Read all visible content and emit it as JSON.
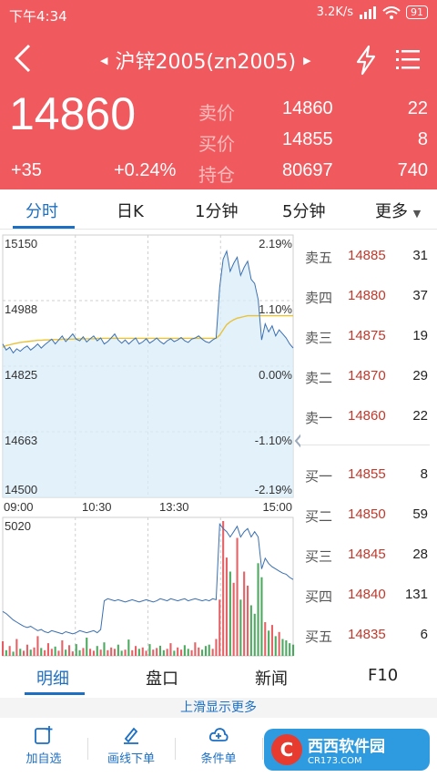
{
  "status": {
    "time": "下午4:34",
    "speed": "3.2K/s",
    "battery": "91"
  },
  "nav": {
    "title": "沪锌2005(zn2005)"
  },
  "quote": {
    "last": "14860",
    "change": "+35",
    "change_pct": "+0.24%",
    "rows": [
      {
        "label": "卖价",
        "v1": "14860",
        "v2": "22"
      },
      {
        "label": "买价",
        "v1": "14855",
        "v2": "8"
      },
      {
        "label": "持仓",
        "v1": "80697",
        "v2": "740"
      }
    ]
  },
  "tabs": [
    "分时",
    "日K",
    "1分钟",
    "5分钟",
    "更多"
  ],
  "chart_data": {
    "type": "line",
    "price_ticks": [
      "15150",
      "14988",
      "14825",
      "14663",
      "14500"
    ],
    "pct_ticks": [
      "2.19%",
      "1.10%",
      "0.00%",
      "-1.10%",
      "-2.19%"
    ],
    "time_ticks": [
      "09:00",
      "10:30",
      "13:30",
      "15:00"
    ],
    "volume_max_label": "5020",
    "ylim": [
      14500,
      15150
    ],
    "base_price": 14825,
    "series": [
      {
        "values": [
          14880,
          14865,
          14872,
          14858,
          14868,
          14862,
          14870,
          14875,
          14865,
          14872,
          14880,
          14870,
          14878,
          14885,
          14892,
          14880,
          14890,
          14900,
          14886,
          14895,
          14905,
          14892,
          14888,
          14898,
          14885,
          14893,
          14900,
          14888,
          14895,
          14880,
          14886,
          14895,
          14905,
          14890,
          14882,
          14890,
          14880,
          14888,
          14895,
          14880,
          14885,
          14893,
          14882,
          14888,
          14895,
          14886,
          14880,
          14888,
          14893,
          14886,
          14890,
          14896,
          14888,
          14884,
          14892,
          14895,
          14900,
          14892,
          14886,
          14883,
          14890,
          14895,
          15020,
          15090,
          15110,
          15060,
          15080,
          15095,
          15050,
          15070,
          15085,
          15040,
          15030,
          14990,
          14890,
          14930,
          14910,
          14925,
          14900,
          14915,
          14905,
          14895,
          14880,
          14870
        ]
      },
      {
        "values": [
          14872,
          14876,
          14878,
          14880,
          14882,
          14884,
          14885,
          14886,
          14887,
          14888,
          14889,
          14889,
          14890,
          14890,
          14891,
          14891,
          14891,
          14892,
          14892,
          14892,
          14892,
          14893,
          14893,
          14893,
          14893,
          14893,
          14893,
          14894,
          14894,
          14894,
          14894,
          14894,
          14894,
          14894,
          14894,
          14894,
          14894,
          14894,
          14894,
          14894,
          14894,
          14894,
          14894,
          14894,
          14894,
          14894,
          14894,
          14894,
          14894,
          14894,
          14894,
          14894,
          14894,
          14894,
          14894,
          14894,
          14894,
          14894,
          14894,
          14894,
          14894,
          14894,
          14902,
          14915,
          14928,
          14935,
          14940,
          14944,
          14946,
          14948,
          14950,
          14950,
          14950,
          14950,
          14950,
          14950,
          14950,
          14950,
          14950,
          14950,
          14950,
          14950,
          14950,
          14950
        ]
      }
    ],
    "volume": [
      52,
      20,
      35,
      15,
      60,
      25,
      18,
      40,
      22,
      30,
      70,
      28,
      20,
      45,
      25,
      33,
      18,
      55,
      22,
      38,
      16,
      42,
      20,
      28,
      65,
      25,
      18,
      35,
      22,
      48,
      20,
      30,
      25,
      40,
      18,
      22,
      58,
      20,
      35,
      25,
      30,
      18,
      42,
      22,
      28,
      36,
      20,
      25,
      45,
      18,
      30,
      22,
      38,
      25,
      20,
      48,
      30,
      22,
      35,
      40,
      25,
      60,
      200,
      480,
      350,
      300,
      260,
      420,
      200,
      300,
      250,
      180,
      150,
      330,
      280,
      120,
      90,
      110,
      70,
      85,
      60,
      55,
      45,
      40
    ],
    "oi": [
      4200,
      4180,
      4150,
      4120,
      4100,
      4080,
      4060,
      4050,
      4060,
      4040,
      4020,
      4030,
      4010,
      4000,
      4020,
      4010,
      4000,
      3990,
      4010,
      4000,
      3990,
      4000,
      4020,
      4010,
      4000,
      4010,
      4020,
      4000,
      4030,
      4300,
      4320,
      4310,
      4300,
      4310,
      4300,
      4290,
      4300,
      4310,
      4300,
      4290,
      4300,
      4310,
      4300,
      4290,
      4300,
      4320,
      4310,
      4300,
      4320,
      4310,
      4300,
      4310,
      4320,
      4300,
      4310,
      4320,
      4310,
      4300,
      4310,
      4300,
      4320,
      4310,
      5020,
      4980,
      4950,
      4900,
      4950,
      5000,
      4900,
      4950,
      4980,
      4900,
      4950,
      4900,
      4600,
      4700,
      4650,
      4620,
      4600,
      4580,
      4560,
      4550,
      4520,
      4500
    ]
  },
  "book": {
    "asks": [
      {
        "label": "卖五",
        "price": "14885",
        "vol": "31"
      },
      {
        "label": "卖四",
        "price": "14880",
        "vol": "37"
      },
      {
        "label": "卖三",
        "price": "14875",
        "vol": "19"
      },
      {
        "label": "卖二",
        "price": "14870",
        "vol": "29"
      },
      {
        "label": "卖一",
        "price": "14860",
        "vol": "22"
      }
    ],
    "bids": [
      {
        "label": "买一",
        "price": "14855",
        "vol": "8"
      },
      {
        "label": "买二",
        "price": "14850",
        "vol": "59"
      },
      {
        "label": "买三",
        "price": "14845",
        "vol": "28"
      },
      {
        "label": "买四",
        "price": "14840",
        "vol": "131"
      },
      {
        "label": "买五",
        "price": "14835",
        "vol": "6"
      }
    ]
  },
  "bottom_tabs": [
    "明细",
    "盘口",
    "新闻",
    "F10"
  ],
  "more_hint": "上滑显示更多",
  "toolbar": {
    "add_watch": "加自选",
    "draw_order": "画线下单",
    "cond_order": "条件单",
    "watermark_title": "西西软件园",
    "watermark_sub": "CR173.COM"
  },
  "colors": {
    "header_bg": "#f05a5e",
    "accent": "#1d6fc4",
    "price_line": "#3a6fb0",
    "avg_line": "#e8c23a",
    "up": "#e0474c",
    "down": "#2e9b45"
  }
}
